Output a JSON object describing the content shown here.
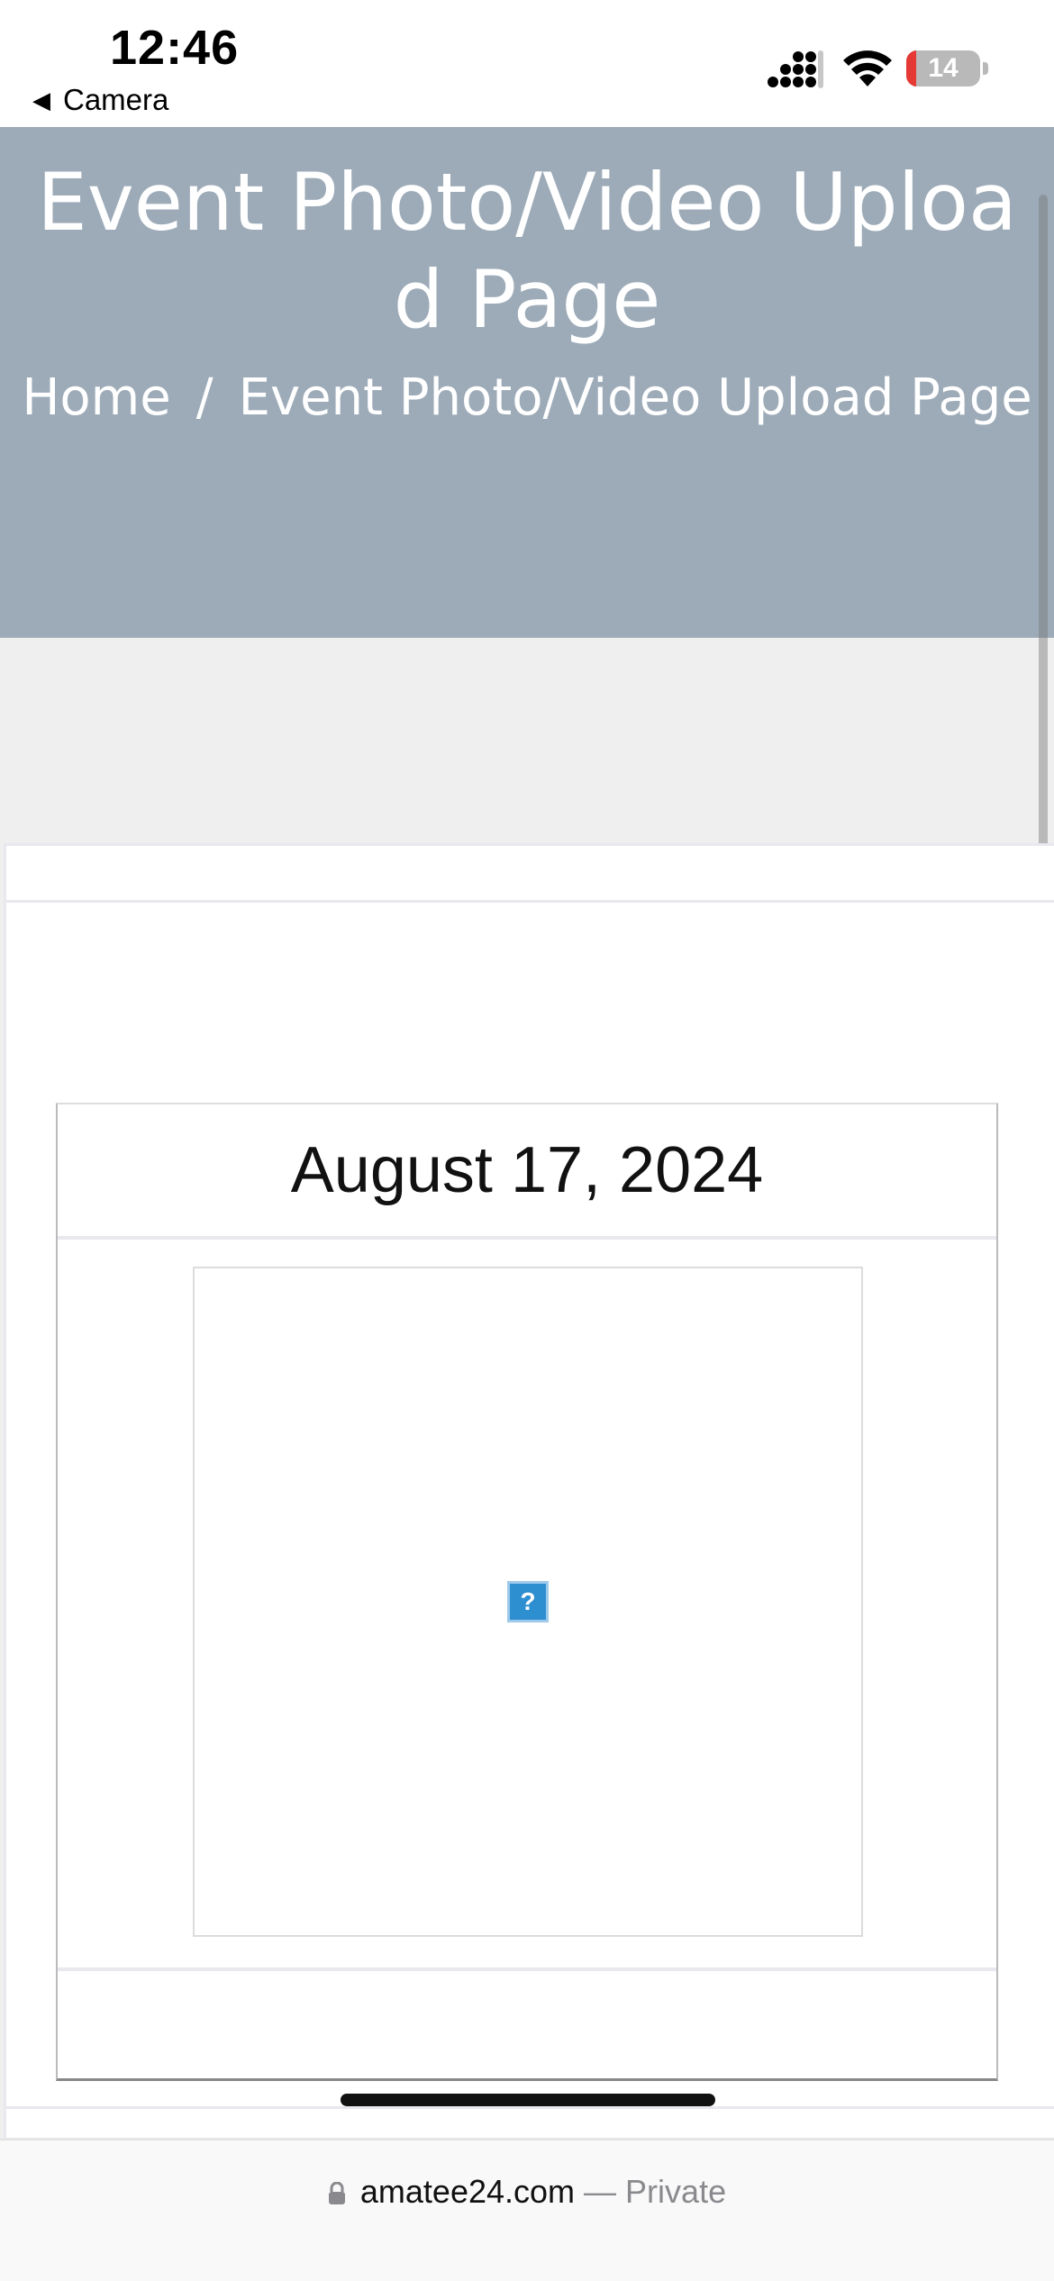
{
  "status_bar": {
    "time": "12:46",
    "back_label": "Camera",
    "battery_percent": "14",
    "battery_color": "#e53935"
  },
  "hero": {
    "title": "Event Photo/Video Upload Page",
    "breadcrumb_home": "Home",
    "breadcrumb_separator": "/",
    "breadcrumb_current": "Event Photo/Video Upload Page",
    "background": "#9dabb8"
  },
  "card": {
    "date": "August 17, 2024",
    "image_placeholder": "?"
  },
  "browser": {
    "domain": "amatee24.com",
    "mode": "— Private"
  }
}
